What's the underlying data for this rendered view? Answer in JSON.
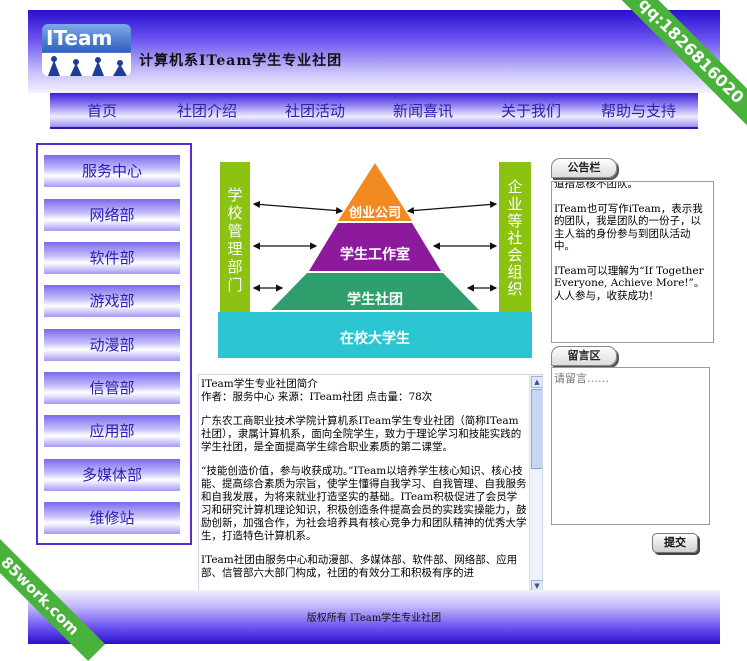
{
  "header": {
    "logo_text": "ITeam",
    "site_title": "计算机系ITeam学生专业社团"
  },
  "nav": {
    "items": [
      {
        "label": "首页"
      },
      {
        "label": "社团介绍"
      },
      {
        "label": "社团活动"
      },
      {
        "label": "新闻喜讯"
      },
      {
        "label": "关于我们"
      },
      {
        "label": "帮助与支持"
      }
    ]
  },
  "sidebar": {
    "items": [
      {
        "label": "服务中心"
      },
      {
        "label": "网络部"
      },
      {
        "label": "软件部"
      },
      {
        "label": "游戏部"
      },
      {
        "label": "动漫部"
      },
      {
        "label": "信管部"
      },
      {
        "label": "应用部"
      },
      {
        "label": "多媒体部"
      },
      {
        "label": "维修站"
      }
    ]
  },
  "diagram": {
    "left_label": "学校管理部门",
    "right_label": "企业等社会组织",
    "tiers": [
      "创业公司",
      "学生工作室",
      "学生社团",
      "在校大学生"
    ],
    "colors": {
      "side": "#8cc210",
      "tier1": "#f28a22",
      "tier2": "#8d1a9c",
      "tier3": "#2f9e6d",
      "tier4": "#2cc6d2"
    }
  },
  "article": {
    "title": "ITeam学生专业社团简介",
    "meta": "作者：服务中心 来源：ITeam社团 点击量：78次",
    "paragraphs": [
      "广东农工商职业技术学院计算机系ITeam学生专业社团（简称ITeam社团），隶属计算机系，面向全院学生，致力于理论学习和技能实践的学生社团，是全面提高学生综合职业素质的第二课堂。",
      "“技能创造价值，参与收获成功。”ITeam以培养学生核心知识、核心技能、提高综合素质为宗旨，使学生懂得自我学习、自我管理、自我服务和自我发展，为将来就业打造坚实的基础。ITeam积极促进了会员学习和研究计算机理论知识，积极创造条件提高会员的实践实操能力，鼓励创新，加强合作，为社会培养具有核心竞争力和团队精神的优秀大学生，打造特色计算机系。",
      "ITeam社团由服务中心和动漫部、多媒体部、软件部、网络部、应用部、信管部六大部门构成，社团的有效分工和积极有序的进"
    ]
  },
  "notice": {
    "tab": "公告栏",
    "paragraphs": [
      "道措息核不团队。",
      "ITeam也可写作iTeam，表示我的团队，我是团队的一份子，以主人翁的身份参与到团队活动中。",
      "ITeam可以理解为“If Together Everyone, Achieve More!”。人人参与，收获成功！"
    ]
  },
  "message": {
    "tab": "留言区",
    "placeholder": "请留言……",
    "submit_label": "提交"
  },
  "footer": {
    "text": "版权所有 ITeam学生专业社团"
  },
  "watermarks": {
    "top_right": "qq:1826816020",
    "bottom_left": "85work.com"
  }
}
